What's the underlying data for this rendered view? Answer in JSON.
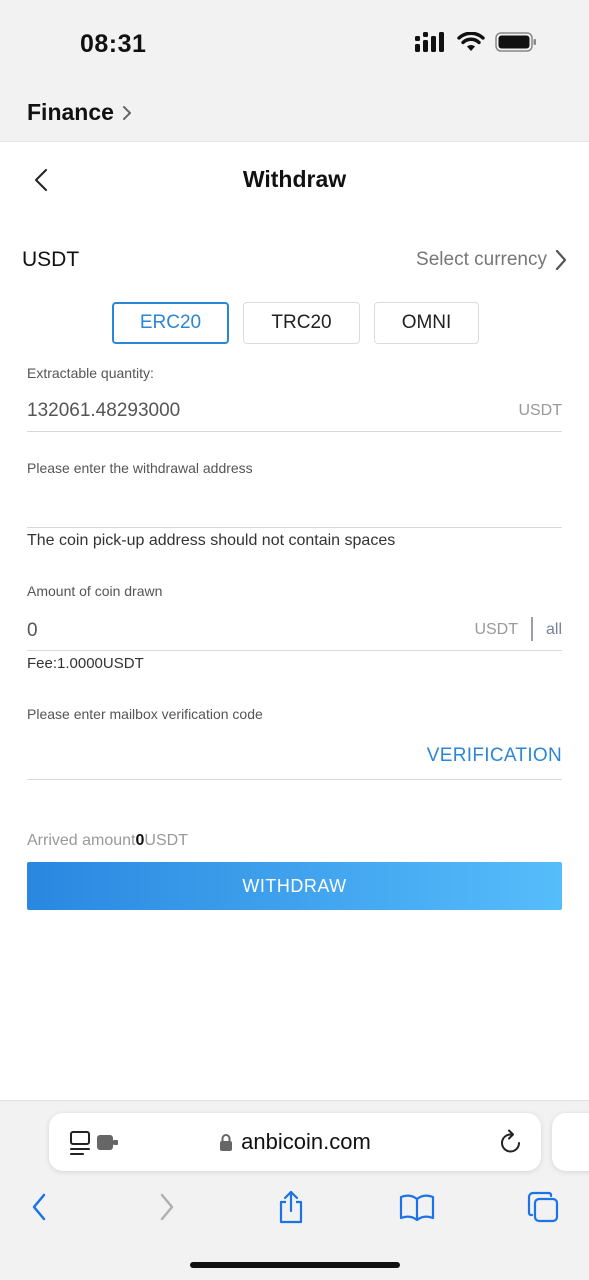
{
  "status_bar": {
    "time": "08:31"
  },
  "breadcrumb": {
    "label": "Finance"
  },
  "header": {
    "title": "Withdraw"
  },
  "currency": {
    "name": "USDT",
    "select_label": "Select currency"
  },
  "chains": [
    {
      "label": "ERC20",
      "active": true
    },
    {
      "label": "TRC20",
      "active": false
    },
    {
      "label": "OMNI",
      "active": false
    }
  ],
  "extractable": {
    "label": "Extractable quantity:",
    "value": "132061.48293000",
    "unit": "USDT"
  },
  "address": {
    "label": "Please enter the withdrawal address",
    "value": "",
    "hint": "The coin pick-up address should not contain spaces"
  },
  "amount": {
    "label": "Amount of coin drawn",
    "value": "0",
    "unit": "USDT",
    "all_label": "all",
    "fee": "Fee:1.0000USDT"
  },
  "verification": {
    "label": "Please enter mailbox verification code",
    "button": "VERIFICATION"
  },
  "arrived": {
    "prefix": "Arrived amount",
    "value": "0",
    "unit": "USDT"
  },
  "withdraw_button": "WITHDRAW",
  "browser": {
    "url": "anbicoin.com"
  },
  "colors": {
    "accent": "#2b86d6",
    "button_gradient_start": "#2a87e0",
    "button_gradient_end": "#56bdfb"
  },
  "icons": [
    "signal-icon",
    "wifi-icon",
    "battery-icon",
    "chevron-right-icon",
    "back-arrow-icon",
    "reader-icon",
    "lock-icon",
    "reload-icon",
    "share-icon",
    "bookmarks-icon",
    "tabs-icon"
  ]
}
